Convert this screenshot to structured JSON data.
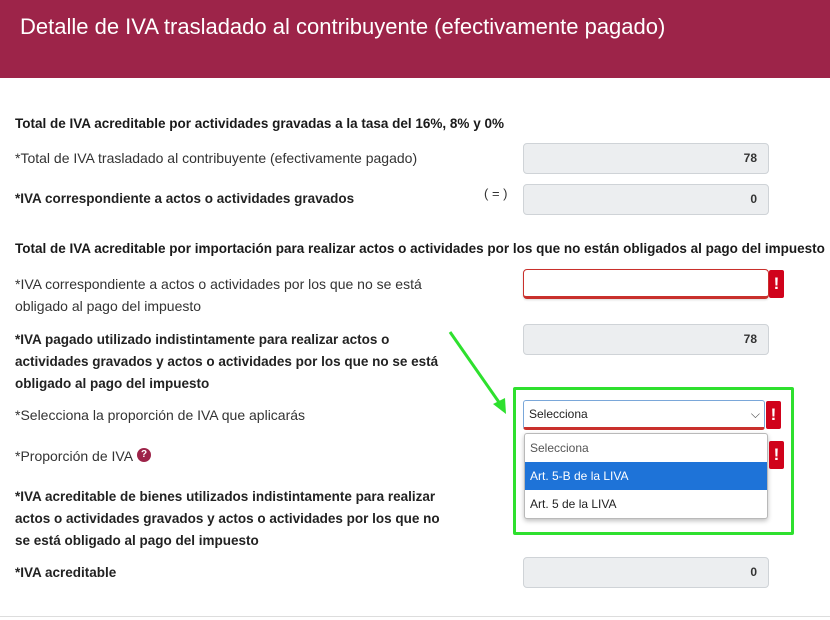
{
  "header": {
    "title": "Detalle de IVA trasladado al contribuyente (efectivamente pagado)"
  },
  "section1": {
    "title": "Total de IVA acreditable por actividades gravadas a la tasa del 16%, 8% y 0%",
    "row1": {
      "label": "*Total de IVA trasladado al contribuyente (efectivamente pagado)",
      "value": "78"
    },
    "operator": "( = )",
    "row2": {
      "label": "*IVA correspondiente a actos o actividades gravados",
      "value": "0"
    }
  },
  "section2": {
    "title": "Total de IVA acreditable por importación para realizar actos o actividades por los que no están obligados al pago del impuesto",
    "row1": {
      "label_line1": "*IVA correspondiente a actos o actividades por los que no se está",
      "label_line2": "obligado al pago del impuesto",
      "value": "",
      "error_mark": "!"
    },
    "row2": {
      "label_line1": "*IVA pagado utilizado indistintamente para realizar actos o",
      "label_line2": "actividades gravados y actos o actividades por los que no se está",
      "label_line3": "obligado al pago del impuesto",
      "value": "78"
    },
    "row3": {
      "label": "*Selecciona la proporción de IVA que aplicarás",
      "selected": "Selecciona",
      "error_mark": "!",
      "options": [
        "Selecciona",
        "Art. 5-B de la LIVA",
        "Art. 5 de la LIVA"
      ],
      "highlighted_option": "Art. 5-B de la LIVA"
    },
    "row4": {
      "label": "*Proporción de IVA",
      "help_icon": "?",
      "error_mark": "!"
    },
    "row5": {
      "label_line1": "*IVA acreditable de bienes utilizados indistintamente para realizar",
      "label_line2": "actos o actividades gravados y actos o actividades por los que no",
      "label_line3": "se está obligado al pago del impuesto"
    },
    "row6": {
      "label": "*IVA acreditable",
      "value": "0"
    }
  },
  "colors": {
    "header_bg": "#9d2449",
    "error": "#d0021b",
    "highlight": "#1e73d8",
    "annotation": "#2ee02e"
  }
}
